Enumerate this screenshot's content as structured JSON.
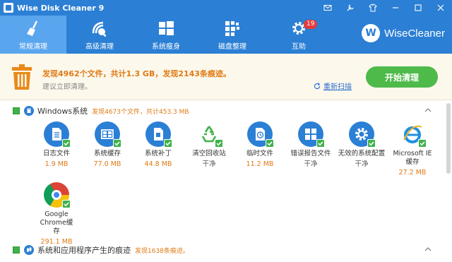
{
  "window": {
    "title": "Wise Disk Cleaner 9",
    "controls": [
      "mail-icon",
      "settings-icon",
      "skin-icon",
      "minimize-icon",
      "maximize-icon",
      "close-icon"
    ]
  },
  "toolbar": {
    "tabs": [
      {
        "label": "常规清理",
        "icon": "broom-icon",
        "active": true
      },
      {
        "label": "高级清理",
        "icon": "advanced-clean-icon",
        "active": false
      },
      {
        "label": "系统瘦身",
        "icon": "windows-icon",
        "active": false
      },
      {
        "label": "磁盘整理",
        "icon": "defrag-icon",
        "active": false
      },
      {
        "label": "互助",
        "icon": "gear-icon",
        "active": false,
        "badge": "19"
      }
    ],
    "brand": {
      "logo": "W",
      "name": "WiseCleaner"
    }
  },
  "summary": {
    "main": "发现4962个文件，共计1.3 GB，发现2143条痕迹。",
    "sub": "建议立即清理。",
    "rescan": "重新扫描",
    "start_button": "开始清理"
  },
  "sections": [
    {
      "title": "Windows系统",
      "info": "发现4673个文件，共计453.3 MB",
      "items": [
        {
          "name": "日志文件",
          "value": "1.9 MB",
          "icon": "log-file-icon"
        },
        {
          "name": "系统缓存",
          "value": "77.0 MB",
          "icon": "system-cache-icon"
        },
        {
          "name": "系统补丁",
          "value": "44.8 MB",
          "icon": "system-patch-icon"
        },
        {
          "name": "清空回收站",
          "value": "干净",
          "icon": "recycle-bin-icon"
        },
        {
          "name": "临时文件",
          "value": "11.2 MB",
          "icon": "temp-file-icon"
        },
        {
          "name": "错误报告文件",
          "value": "干净",
          "icon": "error-report-icon"
        },
        {
          "name": "无效的系统配置",
          "value": "干净",
          "icon": "invalid-config-icon"
        },
        {
          "name": "Microsoft IE 缓存",
          "value": "27.2 MB",
          "icon": "ie-icon"
        },
        {
          "name": "Google Chrome缓存",
          "value": "291.1 MB",
          "icon": "chrome-icon"
        }
      ]
    },
    {
      "title": "系统和应用程序产生的痕迹",
      "info": "发现1638条痕迹。"
    }
  ],
  "colors": {
    "accent": "#2b7fd4",
    "active_tab": "#5aa6ee",
    "orange": "#e07a14",
    "green": "#4dba4a",
    "banner": "#fdf8ec"
  }
}
